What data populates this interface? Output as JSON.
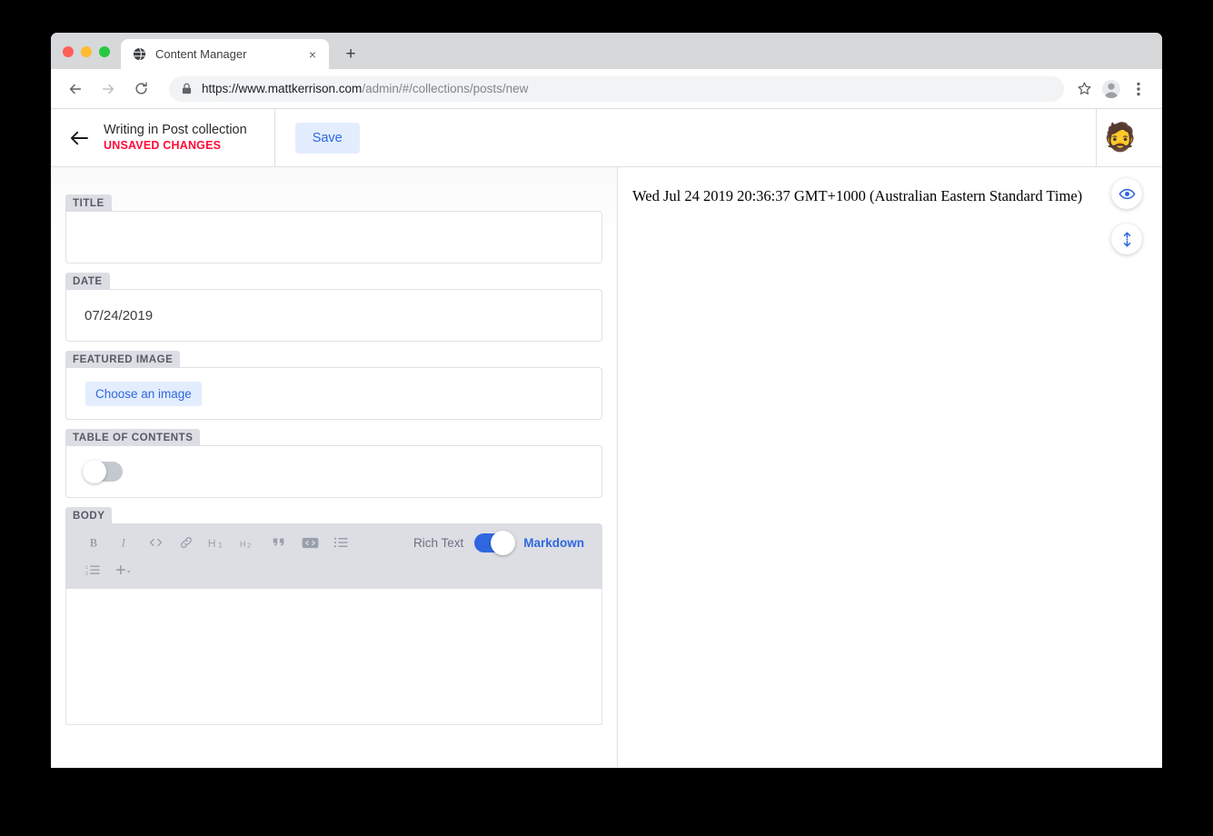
{
  "browser": {
    "tab": {
      "title": "Content Manager",
      "favicon": "globe-icon",
      "close": "×"
    },
    "new_tab_label": "+",
    "omnibox": {
      "scheme_host": "https://www.mattkerrison.com",
      "path": "/admin/#/collections/posts/new",
      "full_url": "https://www.mattkerrison.com/admin/#/collections/posts/new",
      "lock": "lock-icon"
    },
    "actions": {
      "back": "back-arrow-icon",
      "forward": "forward-arrow-icon",
      "reload": "reload-icon",
      "bookmark": "star-icon",
      "menu": "three-dot-menu-icon"
    }
  },
  "app_header": {
    "back": "back-arrow-icon",
    "title": "Writing in Post collection",
    "status": "UNSAVED CHANGES",
    "status_color": "#ff0b37",
    "save_label": "Save",
    "save_bg": "#e3edfd",
    "save_color": "#2f67e0",
    "avatar": "🧔"
  },
  "editor": {
    "fields": [
      {
        "label": "TITLE",
        "type": "text",
        "value": "",
        "name": "title"
      },
      {
        "label": "DATE",
        "type": "text",
        "value": "07/24/2019",
        "name": "date"
      },
      {
        "label": "FEATURED IMAGE",
        "type": "image",
        "button": "Choose an image",
        "name": "featured-image"
      },
      {
        "label": "TABLE OF CONTENTS",
        "type": "toggle",
        "state": "off",
        "name": "table-of-contents"
      },
      {
        "label": "BODY",
        "type": "richtext",
        "value": "",
        "name": "body"
      }
    ],
    "toolbar": {
      "row1": [
        {
          "icon": "bold-icon",
          "label": "B"
        },
        {
          "icon": "italic-icon",
          "label": "I"
        },
        {
          "icon": "inline-code-icon",
          "label": "<>"
        },
        {
          "icon": "link-icon",
          "label": "link"
        },
        {
          "icon": "heading-1-icon",
          "label": "H1"
        },
        {
          "icon": "heading-2-icon",
          "label": "H2"
        },
        {
          "icon": "quote-icon",
          "label": "”"
        },
        {
          "icon": "code-block-icon",
          "label": "<>"
        },
        {
          "icon": "bulleted-list-icon",
          "label": "list"
        }
      ],
      "row2": [
        {
          "icon": "numbered-list-icon",
          "label": "1.2."
        },
        {
          "icon": "add-component-icon",
          "label": "+"
        }
      ]
    },
    "mode_switch": {
      "left_label": "Rich Text",
      "right_label": "Markdown",
      "state": "markdown",
      "active_color": "#2f67e0"
    }
  },
  "preview": {
    "date_text": "Wed Jul 24 2019 20:36:37 GMT+1000 (Australian Eastern Standard Time)",
    "buttons": [
      {
        "icon": "eye-icon",
        "name": "toggle-preview-button"
      },
      {
        "icon": "scroll-sync-icon",
        "name": "toggle-scroll-sync-button"
      }
    ]
  }
}
